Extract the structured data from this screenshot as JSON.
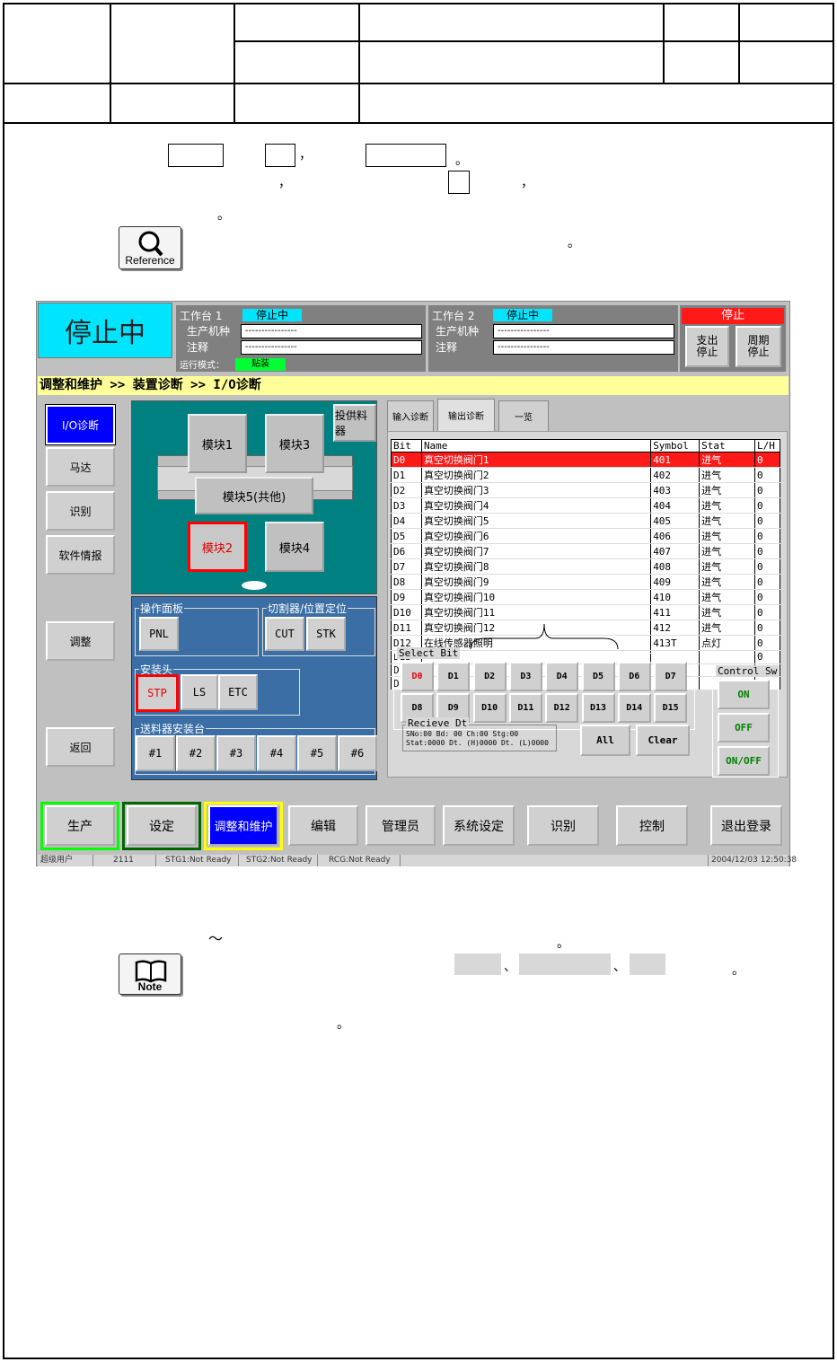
{
  "doc": {
    "reference_label": "Reference",
    "note_label": "Note",
    "line1_period": "。",
    "line1_comma": "，",
    "line2_comma1": "，",
    "line2_comma2": "，",
    "line3_period": "。",
    "ref_period": "。",
    "sec2_tilde": "～",
    "sec2_period": "。",
    "note_sep1": "、",
    "note_sep2": "、",
    "note_period": "。",
    "note_line2_period": "。"
  },
  "screen": {
    "status_text": "停止中",
    "stage1": {
      "title": "工作台 1",
      "state": "停止中",
      "model_label": "生产机种",
      "comment_label": "注释",
      "model_value": "----------------",
      "comment_value": "----------------"
    },
    "stage2": {
      "title": "工作台 2",
      "state": "停止中",
      "model_label": "生产机种",
      "comment_label": "注释",
      "model_value": "----------------",
      "comment_value": "----------------"
    },
    "run_mode_label": "运行模式：",
    "run_mode_value": "贴装",
    "stop_header": "停止",
    "stop_btn1": "支出\n停止",
    "stop_btn2": "周期\n停止",
    "breadcrumb": "调整和维护 >> 装置诊断 >> I/O诊断",
    "side": [
      "I/O诊断",
      "马达",
      "识别",
      "软件情报",
      "调整",
      "返回"
    ],
    "feeder_label": "投供料器",
    "modules": [
      "模块1",
      "模块3",
      "模块5(共他)",
      "模块2",
      "模块4"
    ],
    "groups": {
      "panel": "操作面板",
      "cutter": "切割器/位置定位",
      "head": "安装头",
      "feeder_table": "送料器安装台"
    },
    "panel_btns": [
      "PNL"
    ],
    "cutter_btns": [
      "CUT",
      "STK"
    ],
    "head_btns": [
      "STP",
      "LS",
      "ETC"
    ],
    "feeder_btns": [
      "#1",
      "#2",
      "#3",
      "#4",
      "#5",
      "#6"
    ],
    "tabs": [
      "输入诊断",
      "输出诊断",
      "一览"
    ],
    "table_headers": [
      "Bit",
      "Name",
      "Symbol",
      "Stat",
      "L/H"
    ],
    "rows": [
      [
        "D0",
        "真空切换阀门1",
        "401",
        "进气",
        "0"
      ],
      [
        "D1",
        "真空切换阀门2",
        "402",
        "进气",
        "0"
      ],
      [
        "D2",
        "真空切换阀门3",
        "403",
        "进气",
        "0"
      ],
      [
        "D3",
        "真空切换阀门4",
        "404",
        "进气",
        "0"
      ],
      [
        "D4",
        "真空切换阀门5",
        "405",
        "进气",
        "0"
      ],
      [
        "D5",
        "真空切换阀门6",
        "406",
        "进气",
        "0"
      ],
      [
        "D6",
        "真空切换阀门7",
        "407",
        "进气",
        "0"
      ],
      [
        "D7",
        "真空切换阀门8",
        "408",
        "进气",
        "0"
      ],
      [
        "D8",
        "真空切换阀门9",
        "409",
        "进气",
        "0"
      ],
      [
        "D9",
        "真空切换阀门10",
        "410",
        "进气",
        "0"
      ],
      [
        "D10",
        "真空切换阀门11",
        "411",
        "进气",
        "0"
      ],
      [
        "D11",
        "真空切换阀门12",
        "412",
        "进气",
        "0"
      ],
      [
        "D12",
        "在线传感器照明",
        "413T",
        "点灯",
        "0"
      ],
      [
        "D13",
        "",
        "",
        "",
        "0"
      ],
      [
        "D14",
        "",
        "",
        "",
        "0"
      ],
      [
        "D15",
        "",
        "",
        "",
        "0"
      ]
    ],
    "select_bit_label": "Select Bit",
    "bits_row1": [
      "D0",
      "D1",
      "D2",
      "D3",
      "D4",
      "D5",
      "D6",
      "D7"
    ],
    "bits_row2": [
      "D8",
      "D9",
      "D10",
      "D11",
      "D12",
      "D13",
      "D14",
      "D15"
    ],
    "recieve_label": "Recieve Dt",
    "recieve_line1": "SNo:00 Bd: 00  Ch:00 Stg:00",
    "recieve_line2": "Stat:0000 Dt. (H)0000 Dt. (L)0000",
    "all_btn": "All",
    "clear_btn": "Clear",
    "control_label": "Control Sw",
    "ctl_btns": [
      "ON",
      "OFF",
      "ON/OFF"
    ],
    "bottom": [
      "生产",
      "设定",
      "调整和维护",
      "编辑",
      "管理员",
      "系统设定",
      "识别",
      "控制",
      "退出登录"
    ],
    "statusbar": [
      "超级用户",
      "2111",
      "STG1:Not Ready",
      "STG2:Not Ready",
      "RCG:Not Ready",
      "2004/12/03 12:50:38"
    ],
    "colors": {
      "cyan": "#00e5ff",
      "breadcrumb": "#ffff99",
      "highlight": "#ff1a1a",
      "active": "#0000ff",
      "teal": "#008080",
      "panel_blue": "#3a6ea5"
    }
  }
}
